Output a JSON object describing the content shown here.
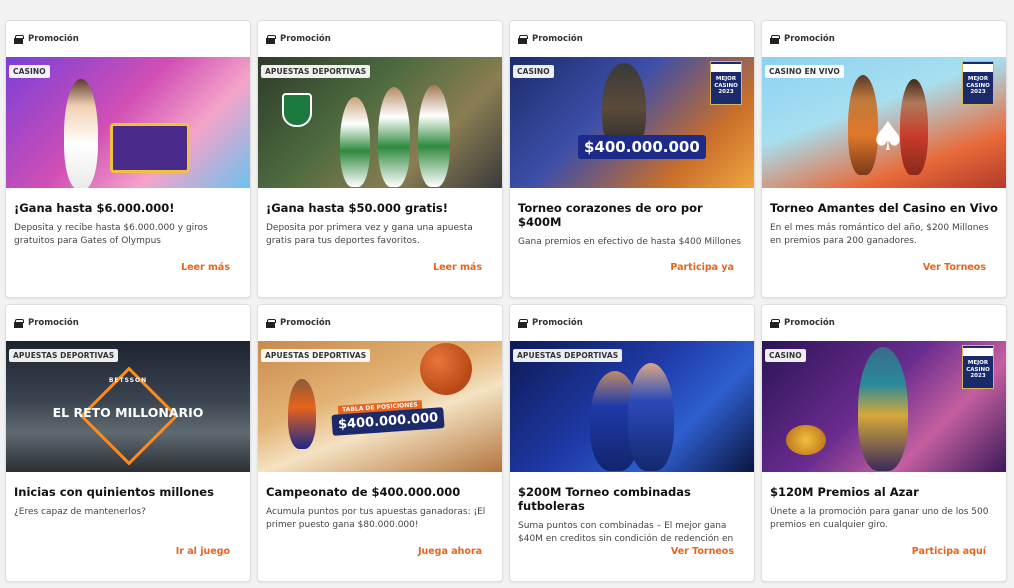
{
  "promo_label": "Promoción",
  "cards": [
    {
      "tag": "CASINO",
      "title": "¡Gana hasta $6.000.000!",
      "description": "Deposita y recibe hasta $6.000.000 y giros gratuitos para Gates of Olympus",
      "cta": "Leer más"
    },
    {
      "tag": "APUESTAS DEPORTIVAS",
      "title": "¡Gana hasta $50.000 gratis!",
      "description": "Deposita por primera vez y gana una apuesta gratis para tus deportes favoritos.",
      "cta": "Leer más"
    },
    {
      "tag": "CASINO",
      "title": "Torneo corazones de oro por $400M",
      "description": "Gana premios en efectivo de hasta $400 Millones",
      "cta": "Participa ya",
      "banner_text": "$400.000.000",
      "badge_text": "MEJOR CASINO 2023"
    },
    {
      "tag": "CASINO EN VIVO",
      "title": "Torneo Amantes del Casino en Vivo",
      "description": "En el mes más romántico del año, $200 Millones en premios para 200 ganadores.",
      "cta": "Ver Torneos",
      "badge_text": "MEJOR CASINO 2023"
    },
    {
      "tag": "APUESTAS DEPORTIVAS",
      "title": "Inicias con quinientos millones",
      "description": "¿Eres capaz de mantenerlos?",
      "cta": "Ir al juego",
      "banner_brand": "BETSSON",
      "banner_text": "EL RETO MILLONARIO"
    },
    {
      "tag": "APUESTAS DEPORTIVAS",
      "title": "Campeonato de $400.000.000",
      "description": "Acumula puntos por tus apuestas ganadoras: ¡El primer puesto gana $80.000.000!",
      "cta": "Juega ahora",
      "banner_subtext": "TABLA DE POSICIONES",
      "banner_text": "$400.000.000"
    },
    {
      "tag": "APUESTAS DEPORTIVAS",
      "title": "$200M Torneo combinadas futboleras",
      "description": "Suma puntos con combinadas – El mejor gana $40M en creditos sin condición de redención en",
      "cta": "Ver Torneos"
    },
    {
      "tag": "CASINO",
      "title": "$120M Premios al Azar",
      "description": "Únete a la promoción para ganar uno de los 500 premios en cualquier giro.",
      "cta": "Participa aquí",
      "badge_text": "MEJOR CASINO 2023"
    }
  ],
  "colors": {
    "accent": "#e8631b",
    "page_bg": "#f2f2f2"
  }
}
